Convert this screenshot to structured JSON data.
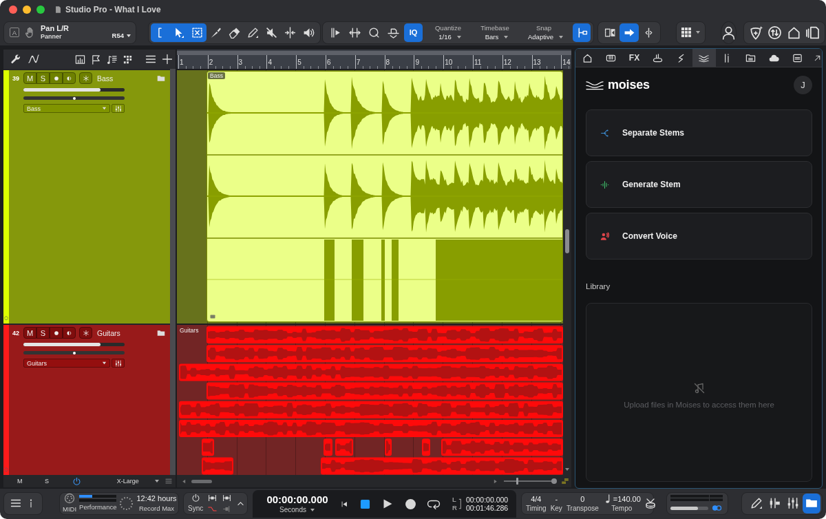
{
  "window": {
    "title": "Studio Pro - What I Love"
  },
  "toolbar": {
    "parameter": {
      "mode": "A",
      "name": "Pan L/R",
      "type": "Panner",
      "value": "R54"
    },
    "tools": [
      {
        "selected": true
      },
      {
        "selected": true
      },
      {
        "selected": true
      },
      {
        "selected": false
      },
      {
        "selected": false
      },
      {
        "selected": false
      },
      {
        "selected": false
      },
      {
        "selected": false
      },
      {
        "selected": false
      }
    ],
    "iq": {
      "label": "IQ",
      "selected": true
    },
    "selectors": [
      {
        "label": "Quantize",
        "value": "1/16"
      },
      {
        "label": "Timebase",
        "value": "Bars"
      },
      {
        "label": "Snap",
        "value": "Adaptive"
      }
    ],
    "snap_toggle": {
      "selected": true
    },
    "edit_modes": [
      {
        "selected": false
      },
      {
        "selected": true
      },
      {
        "selected": false
      }
    ]
  },
  "tracks": [
    {
      "number": "39",
      "name": "Bass",
      "color": "#dcff00",
      "mute": {
        "label": "M",
        "on": false
      },
      "solo": {
        "label": "S",
        "on": false
      },
      "record_armed": false,
      "monitoring": false,
      "volume": {
        "level": 0.76
      },
      "pan": {
        "level": 0.5
      },
      "output": "Bass",
      "clip": {
        "kind": "single",
        "name": "Bass",
        "color": "#ebff88"
      }
    },
    {
      "number": "42",
      "name": "Guitars",
      "color": "#ff1a1a",
      "mute": {
        "label": "M",
        "on": false
      },
      "solo": {
        "label": "S",
        "on": false
      },
      "record_armed": false,
      "monitoring": false,
      "volume": {
        "level": 0.76
      },
      "pan": {
        "level": 0.5
      },
      "output": "Guitars",
      "clip": {
        "kind": "layered",
        "name": "Guitars",
        "color": "#ff0a0a"
      }
    }
  ],
  "track_footer": {
    "mute": "M",
    "solo": "S",
    "power_on": true,
    "size": "X-Large"
  },
  "arrangement": {
    "ruler": [
      "1",
      "2",
      "3",
      "4",
      "5",
      "6",
      "7",
      "8",
      "9",
      "10",
      "11",
      "12",
      "13",
      "14"
    ],
    "zoom": {
      "level": 0.26
    }
  },
  "browser": {
    "tabs": [
      {
        "selected": false
      },
      {
        "selected": false
      },
      {
        "label": "FX",
        "selected": false
      },
      {
        "selected": false
      },
      {
        "selected": false
      },
      {
        "selected": true
      },
      {
        "selected": false
      },
      {
        "selected": false
      },
      {
        "selected": false
      },
      {
        "selected": false
      }
    ],
    "brand": "moises",
    "avatar": "J",
    "actions": [
      {
        "label": "Separate Stems",
        "color": "#3d8fd6"
      },
      {
        "label": "Generate Stem",
        "color": "#3fbf6a"
      },
      {
        "label": "Convert Voice",
        "color": "#e0454a"
      }
    ],
    "library": {
      "title": "Library",
      "empty_text": "Upload files in Moises to access them here"
    }
  },
  "transport": {
    "midi": "MIDI",
    "performance": {
      "label": "Performance",
      "level": 0.35
    },
    "record_max": {
      "value": "12:42 hours",
      "label": "Record Max"
    },
    "sync": "Sync",
    "time": {
      "value": "00:00:00.000",
      "format": "Seconds"
    },
    "buttons": [
      {
        "kind": "rewind",
        "on": false
      },
      {
        "kind": "stop",
        "on": true
      },
      {
        "kind": "play",
        "on": false
      },
      {
        "kind": "record",
        "on": false
      }
    ],
    "locators": [
      {
        "label": "L",
        "value": "00:00:00.000"
      },
      {
        "label": "R",
        "value": "00:01:46.286"
      }
    ],
    "song": [
      {
        "value": "4/4",
        "label": "Timing"
      },
      {
        "value": "-",
        "label": "Key"
      },
      {
        "value": "0",
        "label": "Transpose"
      }
    ],
    "tempo": {
      "value": "=140.00",
      "label": "Tempo"
    },
    "main_volume": {
      "level": 0.73
    },
    "views": [
      {
        "selected": false
      },
      {
        "selected": false
      },
      {
        "selected": false
      },
      {
        "selected": true
      }
    ]
  }
}
